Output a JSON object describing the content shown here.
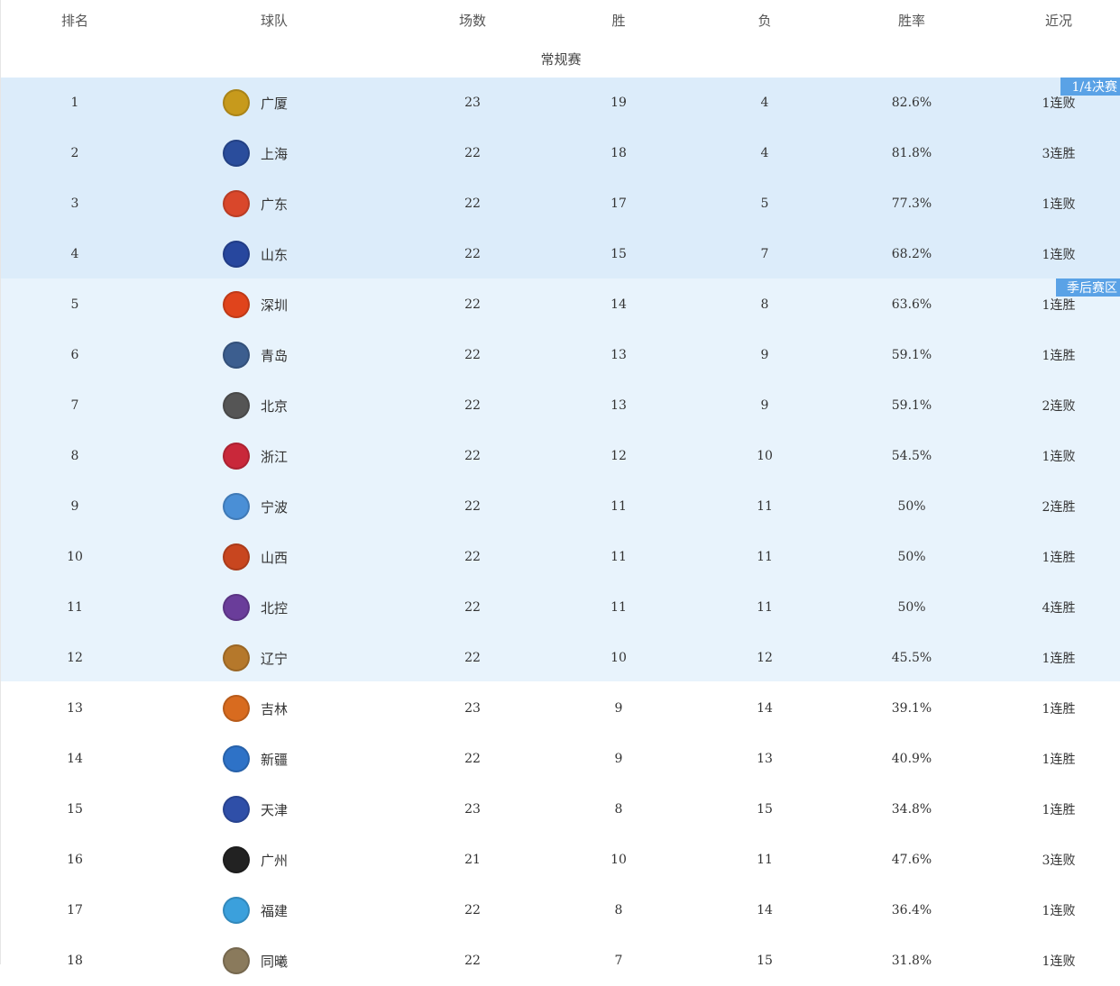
{
  "headers": {
    "rank": "排名",
    "team": "球队",
    "games": "场数",
    "wins": "胜",
    "losses": "负",
    "pct": "胜率",
    "recent": "近况"
  },
  "season_label": "常规赛",
  "zone_tags": {
    "quarterfinal": "1/4决赛",
    "playoff": "季后赛区"
  },
  "rows": [
    {
      "rank": "1",
      "team": "广厦",
      "games": "23",
      "wins": "19",
      "losses": "4",
      "pct": "82.6%",
      "recent": "1连败",
      "logo_color": "#c79a1c"
    },
    {
      "rank": "2",
      "team": "上海",
      "games": "22",
      "wins": "18",
      "losses": "4",
      "pct": "81.8%",
      "recent": "3连胜",
      "logo_color": "#2a4d9c"
    },
    {
      "rank": "3",
      "team": "广东",
      "games": "22",
      "wins": "17",
      "losses": "5",
      "pct": "77.3%",
      "recent": "1连败",
      "logo_color": "#d9472b"
    },
    {
      "rank": "4",
      "team": "山东",
      "games": "22",
      "wins": "15",
      "losses": "7",
      "pct": "68.2%",
      "recent": "1连败",
      "logo_color": "#27479e"
    },
    {
      "rank": "5",
      "team": "深圳",
      "games": "22",
      "wins": "14",
      "losses": "8",
      "pct": "63.6%",
      "recent": "1连胜",
      "logo_color": "#e0441c"
    },
    {
      "rank": "6",
      "team": "青岛",
      "games": "22",
      "wins": "13",
      "losses": "9",
      "pct": "59.1%",
      "recent": "1连胜",
      "logo_color": "#3c5e8f"
    },
    {
      "rank": "7",
      "team": "北京",
      "games": "22",
      "wins": "13",
      "losses": "9",
      "pct": "59.1%",
      "recent": "2连败",
      "logo_color": "#555555"
    },
    {
      "rank": "8",
      "team": "浙江",
      "games": "22",
      "wins": "12",
      "losses": "10",
      "pct": "54.5%",
      "recent": "1连败",
      "logo_color": "#c9283a"
    },
    {
      "rank": "9",
      "team": "宁波",
      "games": "22",
      "wins": "11",
      "losses": "11",
      "pct": "50%",
      "recent": "2连胜",
      "logo_color": "#4a8fd6"
    },
    {
      "rank": "10",
      "team": "山西",
      "games": "22",
      "wins": "11",
      "losses": "11",
      "pct": "50%",
      "recent": "1连胜",
      "logo_color": "#c8461f"
    },
    {
      "rank": "11",
      "team": "北控",
      "games": "22",
      "wins": "11",
      "losses": "11",
      "pct": "50%",
      "recent": "4连胜",
      "logo_color": "#6a3d9a"
    },
    {
      "rank": "12",
      "team": "辽宁",
      "games": "22",
      "wins": "10",
      "losses": "12",
      "pct": "45.5%",
      "recent": "1连胜",
      "logo_color": "#b5782b"
    },
    {
      "rank": "13",
      "team": "吉林",
      "games": "23",
      "wins": "9",
      "losses": "14",
      "pct": "39.1%",
      "recent": "1连胜",
      "logo_color": "#d86b1f"
    },
    {
      "rank": "14",
      "team": "新疆",
      "games": "22",
      "wins": "9",
      "losses": "13",
      "pct": "40.9%",
      "recent": "1连胜",
      "logo_color": "#2e72c7"
    },
    {
      "rank": "15",
      "team": "天津",
      "games": "23",
      "wins": "8",
      "losses": "15",
      "pct": "34.8%",
      "recent": "1连胜",
      "logo_color": "#2f4fa8"
    },
    {
      "rank": "16",
      "team": "广州",
      "games": "21",
      "wins": "10",
      "losses": "11",
      "pct": "47.6%",
      "recent": "3连败",
      "logo_color": "#222222"
    },
    {
      "rank": "17",
      "team": "福建",
      "games": "22",
      "wins": "8",
      "losses": "14",
      "pct": "36.4%",
      "recent": "1连败",
      "logo_color": "#3ba0dc"
    },
    {
      "rank": "18",
      "team": "同曦",
      "games": "22",
      "wins": "7",
      "losses": "15",
      "pct": "31.8%",
      "recent": "1连败",
      "logo_color": "#8a7a5c"
    }
  ]
}
